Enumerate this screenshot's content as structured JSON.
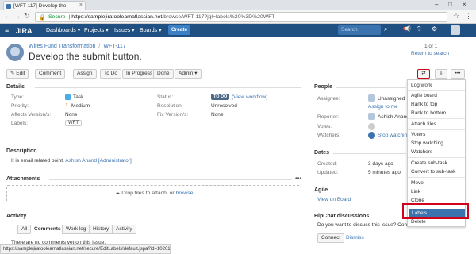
{
  "browser": {
    "tab_title": "[WFT-117] Develop the",
    "secure_label": "Secure",
    "url_host": "https://samplejiratoolearnatlassian.net",
    "url_path": "/browse/WFT-117?jql=labels%20%3D%20WFT"
  },
  "jira_header": {
    "logo": "JIRA",
    "nav": [
      "Dashboards ▾",
      "Projects ▾",
      "Issues ▾",
      "Boards ▾"
    ],
    "create_label": "Create",
    "search_placeholder": "Search"
  },
  "issue": {
    "project": "Wires Fund Transformation",
    "key": "WFT-117",
    "summary": "Develop the submit button.",
    "pager": "1 of 1",
    "return_to_search": "Return to search"
  },
  "toolbar": {
    "edit": "✎ Edit",
    "comment": "Comment",
    "assign": "Assign",
    "todo": "To Do",
    "in_progress": "In Progress",
    "done": "Done",
    "admin": "Admin ▾",
    "more": "•••"
  },
  "details": {
    "heading": "Details",
    "type_label": "Type:",
    "type_value": "Task",
    "priority_label": "Priority:",
    "priority_value": "Medium",
    "affects_label": "Affects Version/s:",
    "affects_value": "None",
    "labels_label": "Labels:",
    "labels_value": "WFT",
    "status_label": "Status:",
    "status_value": "TO DO",
    "status_link": "(View workflow)",
    "resolution_label": "Resolution:",
    "resolution_value": "Unresolved",
    "fix_label": "Fix Version/s:",
    "fix_value": "None"
  },
  "description": {
    "heading": "Description",
    "text": "It is email related point.",
    "mention": "Ashish Anand [Administrator]"
  },
  "attachments": {
    "heading": "Attachments",
    "drop_text": "Drop files to attach, or",
    "browse": "browse"
  },
  "activity": {
    "heading": "Activity",
    "tabs": [
      "All",
      "Comments",
      "Work log",
      "History",
      "Activity"
    ],
    "empty": "There are no comments yet on this issue."
  },
  "people": {
    "heading": "People",
    "assignee_label": "Assignee:",
    "assignee_value": "Unassigned",
    "assign_to_me": "Assign to me",
    "reporter_label": "Reporter:",
    "reporter_value": "Ashish Anand",
    "votes_label": "Votes:",
    "watchers_label": "Watchers:",
    "watchers_value": "Stop watching"
  },
  "dates": {
    "heading": "Dates",
    "created_label": "Created:",
    "created_value": "3 days ago",
    "updated_label": "Updated:",
    "updated_value": "5 minutes ago"
  },
  "agile": {
    "heading": "Agile",
    "link": "View on Board"
  },
  "hipchat": {
    "heading": "HipChat discussions",
    "text": "Do you want to discuss this issue? Connect to HipChat.",
    "connect": "Connect",
    "dismiss": "Dismiss"
  },
  "more_menu": {
    "items": [
      "Log work",
      "Agile board",
      "Rank to top",
      "Rank to bottom",
      "Attach files",
      "Voters",
      "Stop watching",
      "Watchers",
      "Create sub-task",
      "Convert to sub-task",
      "Move",
      "Link",
      "Clone",
      "Labels",
      "Delete"
    ]
  },
  "status_bar_url": "https://samplejiratoolearnatlassian.net/secure/EditLabels!default.jspa?id=10201"
}
